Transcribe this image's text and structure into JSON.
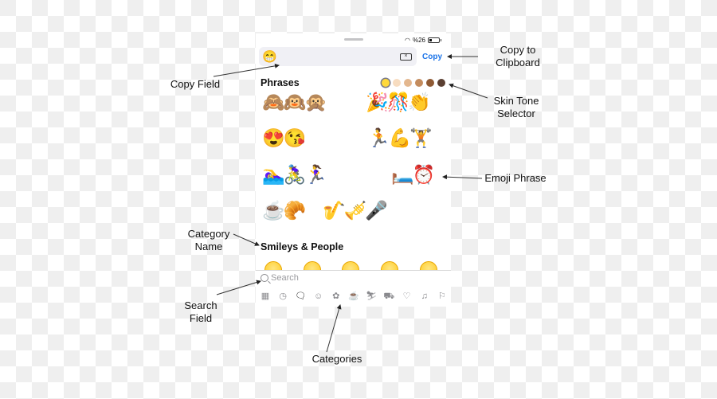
{
  "status_bar": {
    "wifi_icon": "wifi-icon",
    "battery_text": "%26",
    "battery_icon": "battery-icon"
  },
  "copy_field": {
    "value": "😁",
    "clear_icon": "backspace-icon",
    "copy_label": "Copy"
  },
  "phrases_section": {
    "title": "Phrases",
    "skin_tones": [
      {
        "name": "default",
        "color": "#ffd93b",
        "selected": true
      },
      {
        "name": "light",
        "color": "#f7dcc0"
      },
      {
        "name": "medium-light",
        "color": "#e3b78f"
      },
      {
        "name": "medium",
        "color": "#c48c5e"
      },
      {
        "name": "medium-dark",
        "color": "#8f5a34"
      },
      {
        "name": "dark",
        "color": "#5a3f31"
      }
    ],
    "phrases": [
      "🙈🙉🙊",
      "🎉🎊👏",
      "😍😘",
      "🏃💪🏋️",
      "🏊‍♀️🚴‍♀️🏃‍♀️",
      "🛏️⏰",
      "☕🥐",
      "🎷🎺🎤"
    ]
  },
  "smileys_section": {
    "title": "Smileys & People"
  },
  "search": {
    "placeholder": "Search"
  },
  "categories": [
    {
      "name": "frequently-used",
      "glyph": "▦"
    },
    {
      "name": "recent",
      "glyph": "◷"
    },
    {
      "name": "phrases",
      "glyph": "🗨",
      "active": true
    },
    {
      "name": "smileys",
      "glyph": "☺"
    },
    {
      "name": "animals-nature",
      "glyph": "✿"
    },
    {
      "name": "food-drink",
      "glyph": "☕"
    },
    {
      "name": "activity",
      "glyph": "⛷"
    },
    {
      "name": "travel-places",
      "glyph": "⛟"
    },
    {
      "name": "objects",
      "glyph": "♡"
    },
    {
      "name": "symbols",
      "glyph": "♫"
    },
    {
      "name": "flags",
      "glyph": "⚐"
    }
  ],
  "annotations": {
    "copy_to_clipboard": "Copy to Clipboard",
    "copy_field": "Copy Field",
    "skin_tone_selector": "Skin Tone Selector",
    "emoji_phrase": "Emoji Phrase",
    "category_name": "Category Name",
    "search_field": "Search Field",
    "categories": "Categories"
  }
}
